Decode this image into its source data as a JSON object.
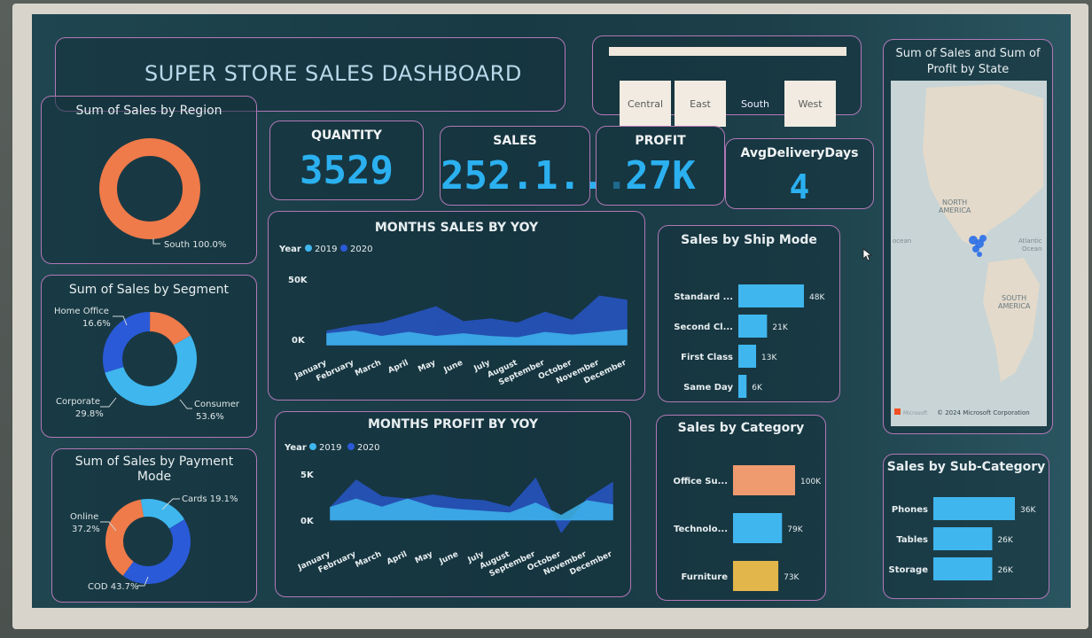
{
  "header": {
    "title": "SUPER STORE SALES DASHBOARD"
  },
  "slicer": {
    "options": [
      "Central",
      "East",
      "South",
      "West"
    ],
    "selected": "South"
  },
  "kpis": {
    "quantity_label": "QUANTITY",
    "quantity_value": "3529",
    "sales_label": "SALES",
    "sales_value": "252.1...",
    "profit_label": "PROFIT",
    "profit_value": "27K",
    "delivery_label": "AvgDeliveryDays",
    "delivery_value": "4"
  },
  "region": {
    "title": "Sum of Sales by Region",
    "slice_label": "South 100.0%"
  },
  "segment": {
    "title": "Sum of Sales by Segment",
    "home_office": "Home Office",
    "home_office_pct": "16.6%",
    "corporate": "Corporate",
    "corporate_pct": "29.8%",
    "consumer": "Consumer",
    "consumer_pct": "53.6%"
  },
  "payment": {
    "title_line1": "Sum of Sales by Payment",
    "title_line2": "Mode",
    "cards": "Cards 19.1%",
    "online": "Online",
    "online_pct": "37.2%",
    "cod": "COD 43.7%"
  },
  "sales_yoy": {
    "title": "MONTHS SALES BY YOY",
    "legend_title": "Year",
    "y_top": "50K",
    "y_zero": "0K"
  },
  "profit_yoy": {
    "title": "MONTHS PROFIT BY YOY",
    "legend_title": "Year",
    "y_top": "5K",
    "y_zero": "0K"
  },
  "ship_mode": {
    "title": "Sales by Ship Mode"
  },
  "category": {
    "title": "Sales by Category"
  },
  "subcategory": {
    "title": "Sales by Sub-Category"
  },
  "map": {
    "title_line1": "Sum of Sales and Sum of",
    "title_line2": "Profit by State",
    "north_america_1": "NORTH",
    "north_america_2": "AMERICA",
    "south_america_1": "SOUTH",
    "south_america_2": "AMERICA",
    "ocean_left": "ocean",
    "ocean_right_1": "Atlantic",
    "ocean_right_2": "Ocean",
    "credit": "© 2024 Microsoft Corporation",
    "brand": "Microsoft"
  },
  "colors": {
    "y2019": "#3fb6ee",
    "y2020": "#2a5ad8",
    "orange": "#ef7a4a",
    "light_blue": "#3fb6ee",
    "category_orange": "#f09a70",
    "category_yellow": "#e2b64a"
  },
  "chart_data": [
    {
      "type": "pie",
      "title": "Sum of Sales by Region",
      "categories": [
        "South"
      ],
      "values": [
        100.0
      ]
    },
    {
      "type": "pie",
      "title": "Sum of Sales by Segment",
      "categories": [
        "Consumer",
        "Corporate",
        "Home Office"
      ],
      "values": [
        53.6,
        29.8,
        16.6
      ]
    },
    {
      "type": "pie",
      "title": "Sum of Sales by Payment Mode",
      "categories": [
        "Cards",
        "COD",
        "Online"
      ],
      "values": [
        19.1,
        43.7,
        37.2
      ]
    },
    {
      "type": "area",
      "title": "MONTHS SALES BY YOY",
      "categories": [
        "January",
        "February",
        "March",
        "April",
        "May",
        "June",
        "July",
        "August",
        "September",
        "October",
        "November",
        "December"
      ],
      "series": [
        {
          "name": "2019",
          "values": [
            8000,
            10000,
            6000,
            9000,
            6000,
            8000,
            6000,
            5000,
            9000,
            7000,
            9000,
            11000
          ]
        },
        {
          "name": "2020",
          "values": [
            10000,
            14000,
            16000,
            22000,
            28000,
            17000,
            19000,
            16000,
            24000,
            18000,
            36000,
            33000
          ]
        }
      ],
      "ylim": [
        0,
        50000
      ]
    },
    {
      "type": "area",
      "title": "MONTHS PROFIT BY YOY",
      "categories": [
        "January",
        "February",
        "March",
        "April",
        "May",
        "June",
        "July",
        "August",
        "September",
        "October",
        "November",
        "December"
      ],
      "series": [
        {
          "name": "2019",
          "values": [
            1500,
            2500,
            1500,
            2500,
            1500,
            1200,
            1000,
            800,
            2000,
            500,
            2300,
            1800
          ]
        },
        {
          "name": "2020",
          "values": [
            1500,
            4800,
            2800,
            2500,
            3000,
            2500,
            2300,
            1500,
            5000,
            -1500,
            2500,
            4500
          ]
        }
      ],
      "ylim": [
        -2000,
        6000
      ]
    },
    {
      "type": "bar",
      "title": "Sales by Ship Mode",
      "categories": [
        "Standard ...",
        "Second Cl...",
        "First Class",
        "Same Day"
      ],
      "values": [
        48000,
        21000,
        13000,
        6000
      ],
      "labels": [
        "48K",
        "21K",
        "13K",
        "6K"
      ]
    },
    {
      "type": "bar",
      "title": "Sales by Category",
      "categories": [
        "Office Su...",
        "Technolo...",
        "Furniture"
      ],
      "values": [
        100000,
        79000,
        73000
      ],
      "labels": [
        "100K",
        "79K",
        "73K"
      ]
    },
    {
      "type": "bar",
      "title": "Sales by Sub-Category",
      "categories": [
        "Phones",
        "Tables",
        "Storage"
      ],
      "values": [
        36000,
        26000,
        26000
      ],
      "labels": [
        "36K",
        "26K",
        "26K"
      ]
    }
  ]
}
